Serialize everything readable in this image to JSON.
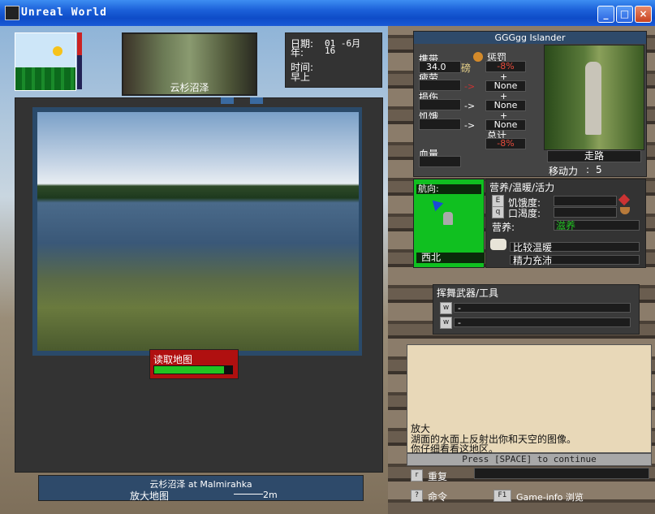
{
  "window": {
    "title": "Unreal World"
  },
  "header": {
    "date_label": "日期:",
    "date_value": "01 -6月",
    "year_label": "年:",
    "year_value": "16",
    "time_label": "时间:",
    "time_value": "早上"
  },
  "location_thumb": {
    "caption": "云杉沼泽"
  },
  "view": {
    "read_map_label": "读取地图"
  },
  "status_bar": {
    "location_line": "云杉沼泽  at Malmirahka",
    "zoom_label": "放大地图",
    "scale_label": "2m"
  },
  "character": {
    "name": "GGGgg Islander",
    "stat1_label": "携带",
    "stat1_value": "34.0",
    "stat1_unit": "磅",
    "stat2_label": "疲劳",
    "stat3_label": "损伤",
    "stat4_label": "饥饿",
    "blood_label": "血量",
    "penalty_label": "惩罚",
    "penalty_value": "-8%",
    "plus1": "+",
    "none1": "None",
    "plus2": "+",
    "none2": "None",
    "plus3": "+",
    "none3": "None",
    "total_label": "总计",
    "total_value": "-8%",
    "walk_label": "走路",
    "move_label": "移动力",
    "move_value": "5"
  },
  "navigation": {
    "heading_label": "航向:",
    "heading_value": "西北"
  },
  "needs": {
    "title": "营养/温暖/活力",
    "hunger_key": "E",
    "hunger_label": "饥饿度:",
    "thirst_key": "q",
    "thirst_label": "口渴度:",
    "nutrition_label": "营养:",
    "nutrition_value": "滋养",
    "warmth_value": "比较温暖",
    "energy_value": "精力充沛"
  },
  "weapons": {
    "title": "挥舞武器/工具",
    "slot1_key": "w",
    "slot1_value": "-",
    "slot2_key": "w",
    "slot2_value": "-"
  },
  "message": {
    "line1": "放大",
    "line2": "湖面的水面上反射出你和天空的图像。",
    "line3": "你仔细看看这地区。",
    "continue_prompt": "Press [SPACE] to continue"
  },
  "commands": {
    "repeat_key": "r",
    "repeat_label": "重复",
    "command_key": "?",
    "command_label": "命令",
    "info_key": "F1",
    "info_label": "Game-info 浏览"
  },
  "colors": {
    "nav_green": "#10c020",
    "read_map_red": "#b01010",
    "accent_green": "#22c322"
  }
}
